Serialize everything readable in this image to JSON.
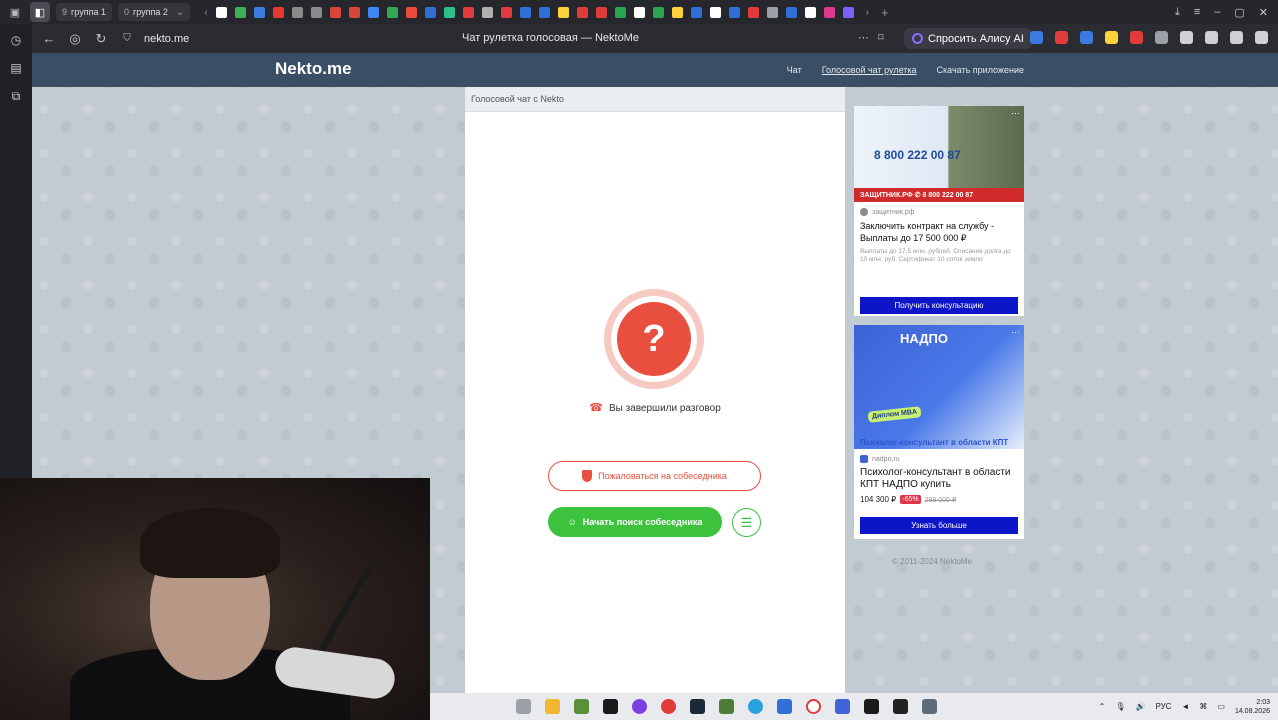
{
  "browser": {
    "tab_groups": [
      {
        "count": "9",
        "label": "группа 1"
      },
      {
        "count": "0",
        "label": "группа 2"
      }
    ],
    "url": "nekto.me",
    "page_title": "Чат рулетка голосовая — NektoMe",
    "alice_button": "Спросить Алису AI"
  },
  "site": {
    "logo": "Nekto.me",
    "nav": [
      "Чат",
      "Голосовой чат рулетка",
      "Скачать приложение"
    ],
    "chat_header": "Голосовой чат с Nekto",
    "status_icon": "?",
    "status_text": "Вы завершили разговор",
    "report_button": "Пожаловаться на собеседника",
    "search_button": "Начать поиск собеседника",
    "copyright": "© 2011-2024 NektoMe"
  },
  "ads": [
    {
      "phone": "8 800 222 00 87",
      "strip": "ЗАЩИТНИК.РФ ✆ 8 800 222 00 87",
      "source": "защитник.рф",
      "title": "Заключить контракт на службу - Выплаты до 17 500 000 ₽",
      "desc": "Выплаты до 17,5 млн. рублей. Списание долга до 10 млн. руб. Сертификат 10 соток земли",
      "cta": "Получить консультацию"
    },
    {
      "logo": "НАДПО",
      "badge": "Диплом MBA",
      "caption": "Психолог-консультант в области КПТ",
      "source": "nadpo.ru",
      "title": "Психолог-консультант в области КПТ НАДПО купить",
      "price": "104 300 ₽",
      "discount": "-65%",
      "old_price": "298 000 ₽",
      "cta": "Узнать больше"
    }
  ],
  "taskbar": {
    "lang": "РУС",
    "time": "2:03",
    "date": "14.08.2026"
  },
  "colors": {
    "header": "#3a4f66",
    "accent_red": "#e84f3f",
    "accent_green": "#3cc23d",
    "ad_cta": "#0d15c8"
  }
}
